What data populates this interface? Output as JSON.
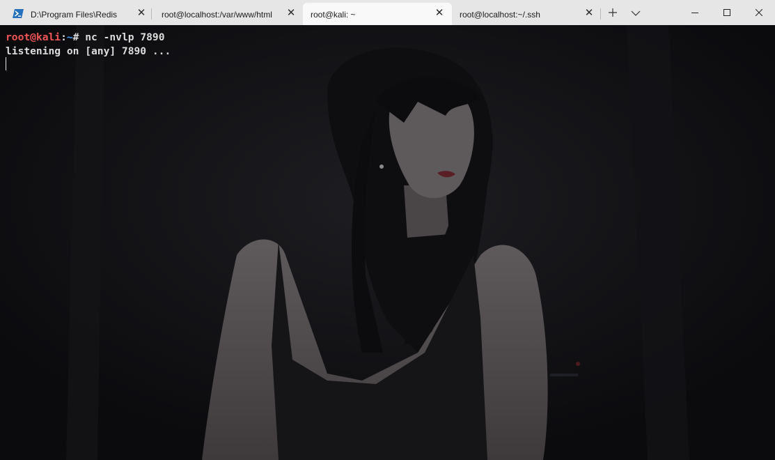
{
  "tabs": [
    {
      "title": "D:\\Program Files\\Redis",
      "icon": "powershell-icon",
      "active": false
    },
    {
      "title": "root@localhost:/var/www/html",
      "active": false
    },
    {
      "title": "root@kali: ~",
      "active": true
    },
    {
      "title": "root@localhost:~/.ssh",
      "active": false
    }
  ],
  "toolbar": {
    "new_tab_icon": "plus-icon",
    "dropdown_icon": "chevron-down-icon"
  },
  "window_controls": {
    "minimize_icon": "minimize-icon",
    "maximize_icon": "maximize-icon",
    "close_icon": "close-icon"
  },
  "terminal": {
    "prompt_user": "root@kali",
    "prompt_sep": ":",
    "prompt_path": "~",
    "prompt_symbol": "#",
    "command": " nc -nvlp 7890",
    "output": "listening on [any] 7890 ..."
  },
  "colors": {
    "prompt_user": "#f05454",
    "prompt_path": "#3ea2ff",
    "tabbar_bg": "#e6e6e6",
    "active_tab_bg": "#f9f9f9",
    "terminal_bg": "#0d0d10"
  },
  "background_image": "woman-in-black-dress-wallpaper"
}
